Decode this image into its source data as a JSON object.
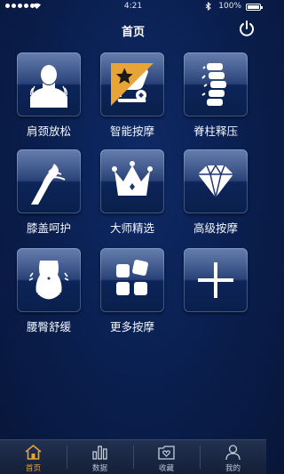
{
  "status_bar": {
    "time": "4:21",
    "battery": "100%"
  },
  "header": {
    "title": "首页"
  },
  "tiles": [
    {
      "label": "肩颈放松",
      "icon": "neck-shoulder-icon"
    },
    {
      "label": "智能按摩",
      "icon": "massage-chair-icon",
      "badge": "star-icon"
    },
    {
      "label": "脊柱释压",
      "icon": "spine-icon"
    },
    {
      "label": "膝盖呵护",
      "icon": "knee-icon"
    },
    {
      "label": "大师精选",
      "icon": "crown-icon"
    },
    {
      "label": "高级按摩",
      "icon": "diamond-icon"
    },
    {
      "label": "腰臀舒缓",
      "icon": "waist-icon"
    },
    {
      "label": "更多按摩",
      "icon": "grid-icon"
    },
    {
      "label": "",
      "icon": "plus-icon"
    }
  ],
  "tab_bar": [
    {
      "label": "首页",
      "icon": "home-icon",
      "active": true
    },
    {
      "label": "数据",
      "icon": "bar-chart-icon",
      "active": false
    },
    {
      "label": "收藏",
      "icon": "favorites-icon",
      "active": false
    },
    {
      "label": "我的",
      "icon": "profile-icon",
      "active": false
    }
  ],
  "colors": {
    "accent": "#e8a436",
    "background": "#0a1e4d",
    "tile": "#1d3770"
  }
}
